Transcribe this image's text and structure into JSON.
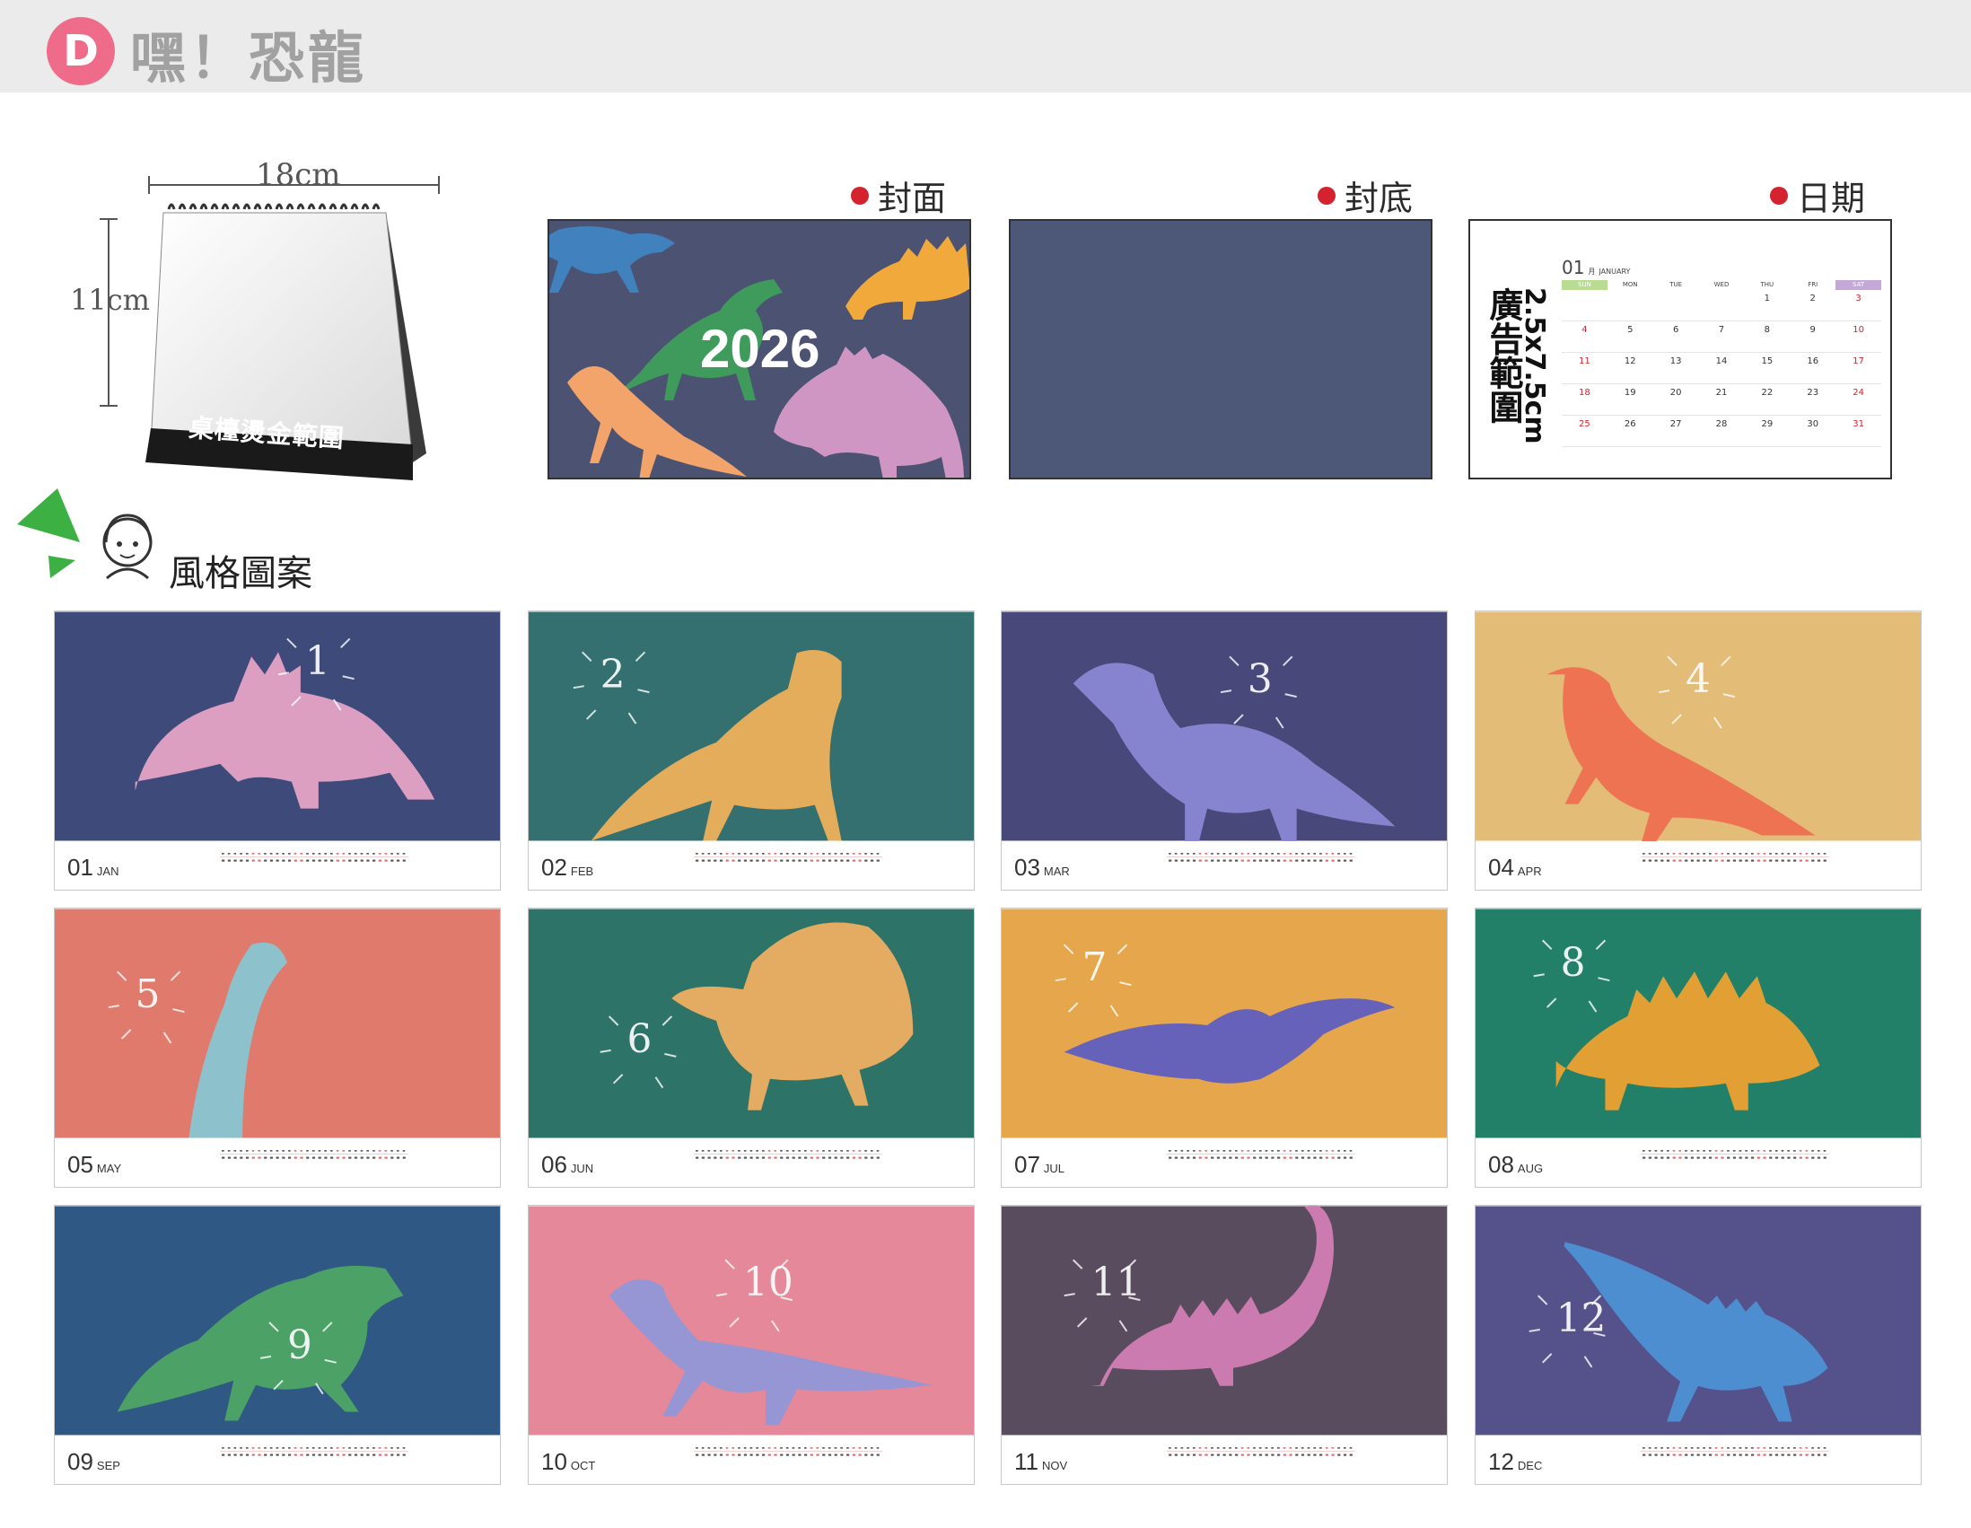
{
  "header": {
    "badge": "D",
    "title": "嘿！恐龍"
  },
  "desk": {
    "width_label": "18cm",
    "height_label": "11cm",
    "base_label": "桌檯燙金範圍"
  },
  "sections": {
    "cover_label": "封面",
    "back_label": "封底",
    "date_label": "日期",
    "style_label": "風格圖案"
  },
  "cover": {
    "year": "2026"
  },
  "date_panel": {
    "ad_range": "廣告範圍",
    "ad_size": "2.5x7.5cm",
    "month_num": "01",
    "month_cn": "月",
    "month_en": "JANUARY",
    "weekdays": [
      "SUN",
      "MON",
      "TUE",
      "WED",
      "THU",
      "FRI",
      "SAT"
    ]
  },
  "months": [
    {
      "num": "01",
      "abbr": "JAN",
      "bg": "#3e4b7a",
      "digit": "1"
    },
    {
      "num": "02",
      "abbr": "FEB",
      "bg": "#33706f",
      "digit": "2"
    },
    {
      "num": "03",
      "abbr": "MAR",
      "bg": "#48497a",
      "digit": "3"
    },
    {
      "num": "04",
      "abbr": "APR",
      "bg": "#e3bc78",
      "digit": "4"
    },
    {
      "num": "05",
      "abbr": "MAY",
      "bg": "#df7a6c",
      "digit": "5"
    },
    {
      "num": "06",
      "abbr": "JUN",
      "bg": "#2e7367",
      "digit": "6"
    },
    {
      "num": "07",
      "abbr": "JUL",
      "bg": "#e6a64c",
      "digit": "7"
    },
    {
      "num": "08",
      "abbr": "AUG",
      "bg": "#228068",
      "digit": "8"
    },
    {
      "num": "09",
      "abbr": "SEP",
      "bg": "#2f5984",
      "digit": "9"
    },
    {
      "num": "10",
      "abbr": "OCT",
      "bg": "#e5889a",
      "digit": "10"
    },
    {
      "num": "11",
      "abbr": "NOV",
      "bg": "#5a4c5f",
      "digit": "11"
    },
    {
      "num": "12",
      "abbr": "DEC",
      "bg": "#55528b",
      "digit": "12"
    }
  ],
  "colors": {
    "accent_pink": "#ef6b8a",
    "dot_red": "#d4232f",
    "header_bg": "#ebebeb"
  }
}
